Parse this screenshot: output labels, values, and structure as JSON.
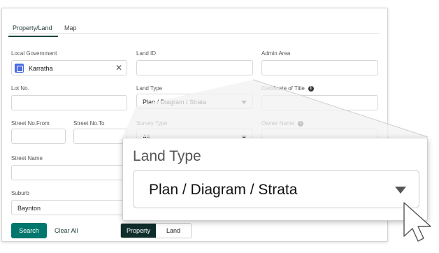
{
  "tabs": [
    {
      "label": "Property/Land",
      "active": true
    },
    {
      "label": "Map",
      "active": false
    }
  ],
  "form": {
    "local_government": {
      "label": "Local Government",
      "value": "Karratha",
      "clear": "✕"
    },
    "land_id": {
      "label": "Land ID",
      "value": ""
    },
    "admin_area": {
      "label": "Admin Area",
      "value": ""
    },
    "lot_no": {
      "label": "Lot No.",
      "value": ""
    },
    "land_type": {
      "label": "Land Type",
      "value": "Plan / Diagram / Strata"
    },
    "certificate_of_title": {
      "label": "Certificate of Title",
      "info": "i",
      "value": ""
    },
    "street_no_from": {
      "label": "Street No.From",
      "value": ""
    },
    "street_no_to": {
      "label": "Street No.To",
      "value": ""
    },
    "survey_type": {
      "label": "Survey Type",
      "value": "All"
    },
    "owner_name": {
      "label": "Owner Name",
      "info": "i",
      "value": ""
    },
    "street_name": {
      "label": "Street Name",
      "value": ""
    },
    "suburb": {
      "label": "Suburb",
      "value": "Baynton"
    }
  },
  "actions": {
    "search": "Search",
    "clear_all": "Clear All",
    "toggle": [
      "Property",
      "Land"
    ]
  },
  "zoom": {
    "label": "Land Type",
    "value": "Plan / Diagram / Strata"
  },
  "colors": {
    "primary": "#00776d",
    "dark": "#0f2d2b",
    "chip_icon": "#4a6ce0"
  },
  "icons": [
    "building-icon",
    "close-icon",
    "info-icon",
    "chevron-down-icon",
    "cursor-pointer-icon"
  ]
}
